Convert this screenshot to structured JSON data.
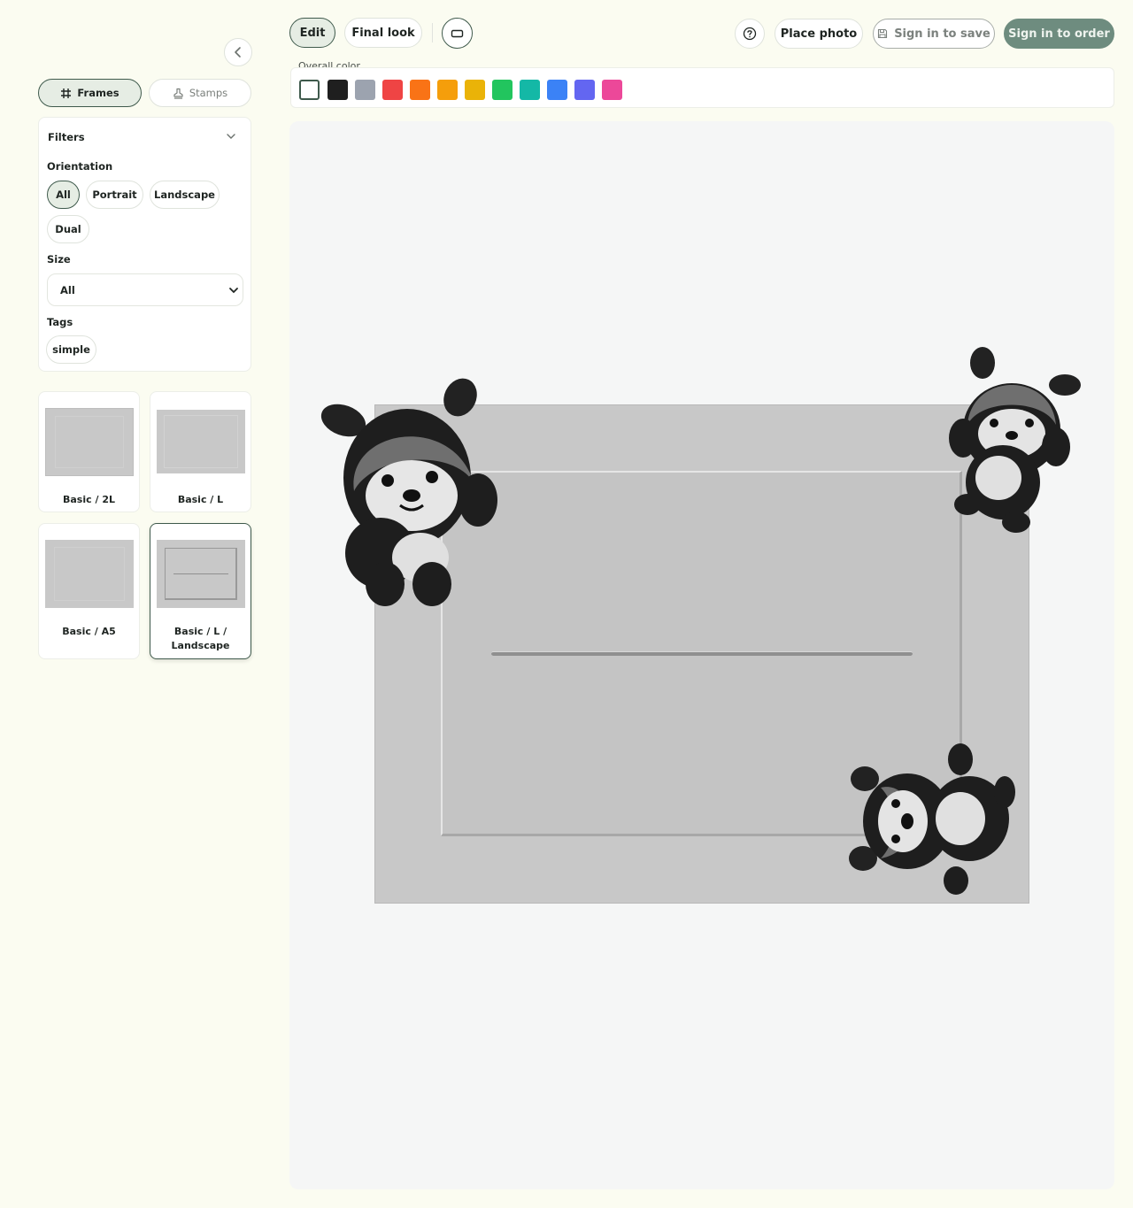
{
  "sidebar": {
    "tabs": {
      "frames": "Frames",
      "stamps": "Stamps"
    },
    "filters": {
      "title": "Filters",
      "orientation_label": "Orientation",
      "orientation_options": [
        "All",
        "Portrait",
        "Landscape",
        "Dual"
      ],
      "orientation_selected": "All",
      "size_label": "Size",
      "size_value": "All",
      "tags_label": "Tags",
      "tags": [
        "simple"
      ]
    },
    "frames": [
      {
        "name": "Basic / 2L"
      },
      {
        "name": "Basic / L"
      },
      {
        "name": "Basic / A5"
      },
      {
        "name": "Basic / L / Landscape",
        "line1": "Basic / L /",
        "line2": "Landscape",
        "selected": true
      }
    ]
  },
  "toolbar": {
    "edit": "Edit",
    "final_look": "Final look",
    "place_photo": "Place photo",
    "sign_in_save": "Sign in to save",
    "sign_in_order": "Sign in to order"
  },
  "overall_color": {
    "label": "Overall color",
    "swatches": [
      "#ffffff",
      "#1f1f1f",
      "#9ca3af",
      "#ef4444",
      "#f97316",
      "#f59e0b",
      "#eab308",
      "#22c55e",
      "#14b8a6",
      "#3b82f6",
      "#6366f1",
      "#ec4899"
    ],
    "selected": "#ffffff"
  },
  "colors": {
    "accent": "#3f5a4c",
    "order_button": "#6e8c7f",
    "page_bg": "#fbfcf1",
    "canvas_bg": "#f5f6f6",
    "frame": "#c8c8c8"
  },
  "icons": {
    "collapse": "chevron-left-icon",
    "frames": "hash-icon",
    "stamps": "stamp-icon",
    "ratio": "rectangle-icon",
    "help": "help-circle-icon",
    "save": "floppy-icon"
  }
}
